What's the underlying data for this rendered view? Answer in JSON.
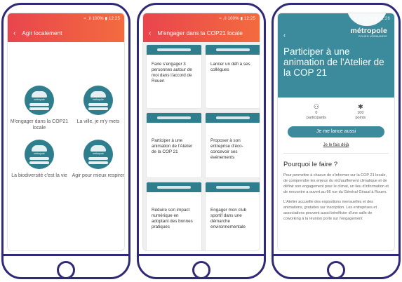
{
  "phone1": {
    "status": "≈ .il 100% ▮ 12:25",
    "title": "Agir localement",
    "items": [
      {
        "label": "M'engager dans la COP21 locale",
        "badge": "métropole"
      },
      {
        "label": "La ville, je m'y mets",
        "badge": "métropole"
      },
      {
        "label": "La biodiversité c'est la vie",
        "badge": "métropole"
      },
      {
        "label": "Agir pour mieux respirer",
        "badge": "métropole"
      }
    ]
  },
  "phone2": {
    "status": "≈ .il 100% ▮ 12:25",
    "title": "M'engager dans la COP21 locale",
    "cards": [
      {
        "text": "Faire s'engager 3 personnes autour de moi dans l'accord de Rouen"
      },
      {
        "text": "Lancer un défi à ses collègues"
      },
      {
        "text": "Participer à une animation de l'Atelier de la COP 21"
      },
      {
        "text": "Proposer à son entreprise d'éco-concevoir ses événements"
      },
      {
        "text": "Réduire son impact numérique en adoptant des bonnes pratiques"
      },
      {
        "text": "Engager mon club sportif dans une démarche environnementale"
      }
    ]
  },
  "phone3": {
    "status": "≈ .il 100% ▮ 12:26",
    "brand": "métropole",
    "brand_sub": "ROUEN NORMANDIE",
    "title": "Participer à une animation de l'Atelier de la COP 21",
    "stats": [
      {
        "value": "0",
        "label": "participants",
        "icon": "people-icon"
      },
      {
        "value": "100",
        "label": "points",
        "icon": "star-icon"
      }
    ],
    "cta": "Je me lance aussi",
    "link": "Je le fais déjà",
    "section_title": "Pourquoi le faire ?",
    "paragraph1": "Pour permettre à chacun de s'informer sur la COP 21 locale, de comprendre les enjeux du réchauffement climatique et de définir son engagement pour le climat, un lieu d'information et de rencontre a ouvert au 66 rue du Général Giraud à Rouen.",
    "paragraph2": "L'Atelier accueille des expositions mensuelles et des animations, gratuites sur inscription. Les entreprises et associations peuvent aussi bénéficier d'une salle de coworking à la réunion porte sur l'engagement"
  }
}
